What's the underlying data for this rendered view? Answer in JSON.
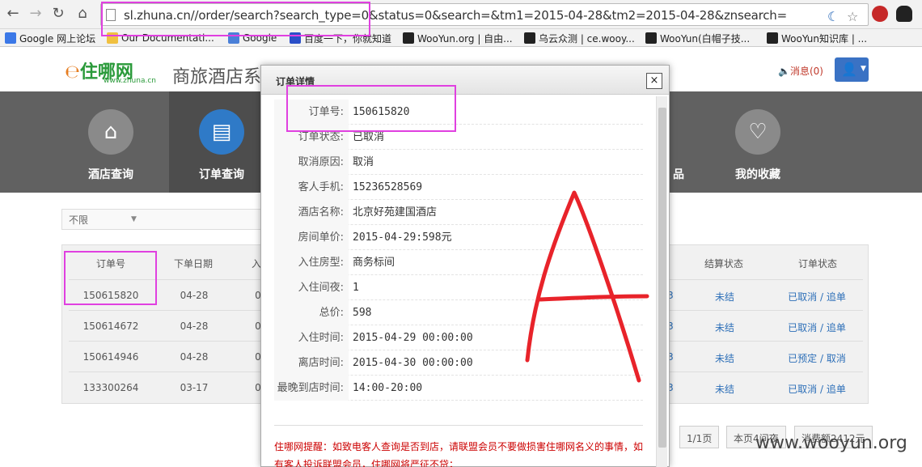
{
  "browser": {
    "url": "sl.zhuna.cn//order/search?search_type=0&status=0&search=&tm1=2015-04-28&tm2=2015-04-28&znsearch=",
    "bookmarks": [
      "Google 网上论坛",
      "Our Documentati...",
      "Google",
      "百度一下，你就知道",
      "WooYun.org | 自由...",
      "乌云众测 | ce.wooy...",
      "WooYun(白帽子技...",
      "WooYun知识库 | ..."
    ]
  },
  "header": {
    "logo": "住哪网",
    "logo_sub": "www.zhuna.cn",
    "site_title": "商旅酒店系",
    "message": "消息(0)"
  },
  "nav": {
    "items": [
      {
        "label": "酒店查询",
        "icon": "house-icon"
      },
      {
        "label": "订单查询",
        "icon": "document-icon"
      },
      {
        "label": "品",
        "icon": ""
      },
      {
        "label": "我的收藏",
        "icon": "favorite-icon"
      }
    ]
  },
  "filter": {
    "value": "不限"
  },
  "table": {
    "headers": [
      "订单号",
      "下单日期",
      "入",
      "结算状态",
      "订单状态"
    ],
    "rows": [
      {
        "order_no": "150615820",
        "date": "04-28",
        "partial": "0",
        "right_partial": "3",
        "settle": "未结",
        "status": "已取消 / 追单"
      },
      {
        "order_no": "150614672",
        "date": "04-28",
        "partial": "0",
        "right_partial": "3",
        "settle": "未结",
        "status": "已取消 / 追单"
      },
      {
        "order_no": "150614946",
        "date": "04-28",
        "partial": "0",
        "right_partial": "3",
        "settle": "未结",
        "status": "已预定 / 取消"
      },
      {
        "order_no": "133300264",
        "date": "03-17",
        "partial": "0",
        "right_partial": "3",
        "settle": "未结",
        "status": "已取消 / 追单"
      }
    ]
  },
  "pagination": {
    "page": "1/1页",
    "this_page": "本页4间夜",
    "total": "消费额2412元"
  },
  "modal": {
    "title": "订单详情",
    "close": "×",
    "fields": [
      {
        "label": "订单号:",
        "value": "150615820"
      },
      {
        "label": "订单状态:",
        "value": "已取消"
      },
      {
        "label": "取消原因:",
        "value": "取消"
      },
      {
        "label": "客人手机:",
        "value": "15236528569"
      },
      {
        "label": "酒店名称:",
        "value": "北京好苑建国酒店"
      },
      {
        "label": "房间单价:",
        "value": "2015-04-29:598元"
      },
      {
        "label": "入住房型:",
        "value": "商务标间"
      },
      {
        "label": "入住间夜:",
        "value": "1"
      },
      {
        "label": "总价:",
        "value": "598"
      },
      {
        "label": "入住时间:",
        "value": "2015-04-29 00:00:00"
      },
      {
        "label": "离店时间:",
        "value": "2015-04-30 00:00:00"
      },
      {
        "label": "最晚到店时间:",
        "value": "14:00-20:00"
      }
    ],
    "notice": "住哪网提醒：如致电客人查询是否到店，请联盟会员不要做损害住哪网名义的事情，如有客人投诉联盟会员，住哪网将严征不贷；"
  },
  "watermark": "www.wooyun.org",
  "colors": {
    "nav_bg": "#616161",
    "nav_active": "#2f7ac7",
    "highlight": "#e040e0",
    "annotation": "#e8232a"
  }
}
